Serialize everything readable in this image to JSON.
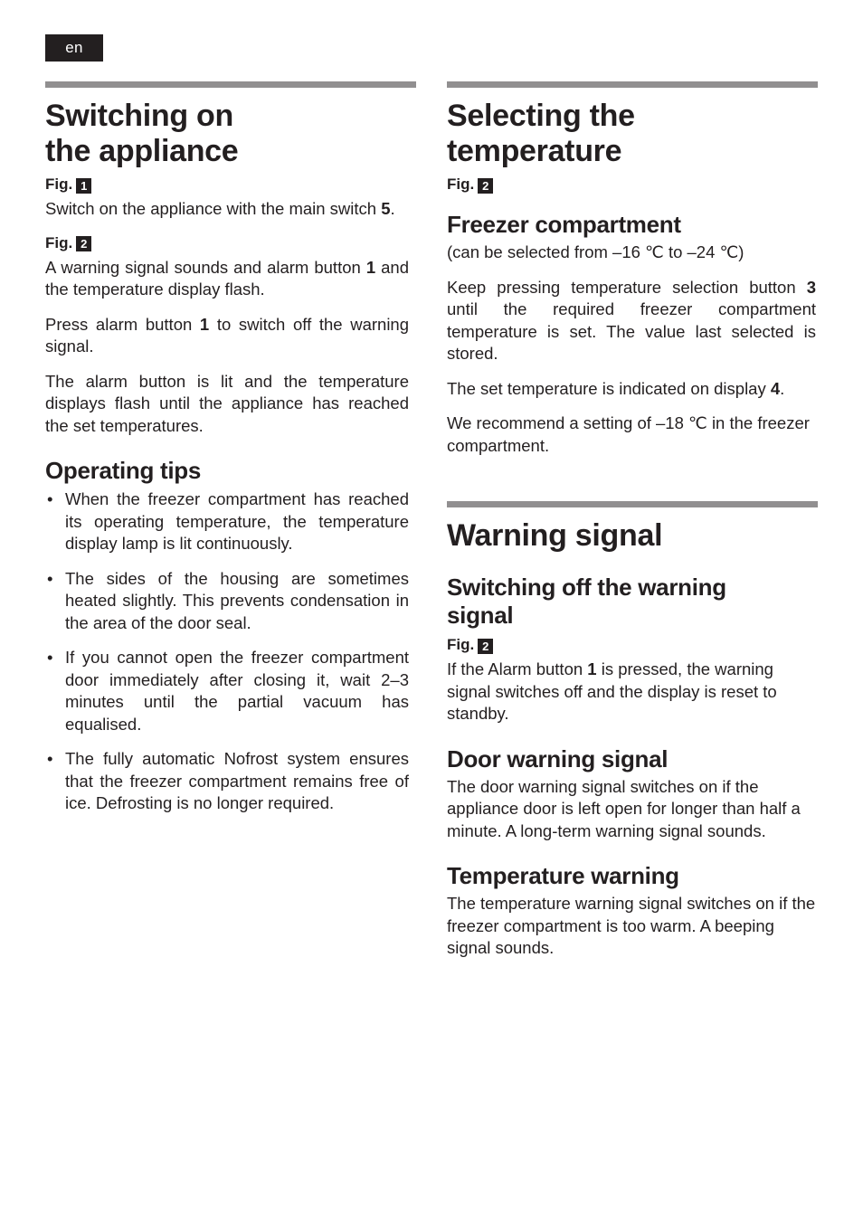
{
  "language_badge": "en",
  "left_column": {
    "section": {
      "title_line1": "Switching on",
      "title_line2": "the appliance"
    },
    "fig1": {
      "label": "Fig.",
      "number": "1"
    },
    "para_switch_on": "Switch on the appliance with the main switch 5.",
    "para_switch_on_parts": {
      "a": "Switch on the appliance with the main switch ",
      "bold": "5",
      "b": "."
    },
    "fig2": {
      "label": "Fig.",
      "number": "2"
    },
    "para_warning_parts": {
      "a": "A warning signal sounds and alarm button ",
      "bold": "1",
      "b": " and the temperature display flash."
    },
    "para_press_parts": {
      "a": "Press alarm button ",
      "bold": "1",
      "b": " to switch off the warning signal."
    },
    "para_alarm_lit": "The alarm button is lit and the temperature displays flash until the appliance has reached the set temperatures.",
    "operating_tips": {
      "heading": "Operating tips",
      "items": [
        "When the freezer compartment has reached its operating temperature, the temperature display lamp is lit continuously.",
        "The sides of the housing are sometimes heated slightly. This prevents condensation in the area of the door seal.",
        "If you cannot open the freezer compartment door immediately after closing it, wait 2–3 minutes until the partial vacuum has equalised.",
        "The fully automatic Nofrost system ensures that the freezer compartment remains free of ice. Defrosting is no longer required."
      ]
    }
  },
  "right_column": {
    "section_temperature": {
      "title_line1": "Selecting the",
      "title_line2": "temperature",
      "fig": {
        "label": "Fig.",
        "number": "2"
      },
      "sub_heading": "Freezer compartment",
      "range_note": "(can be selected from –16 ℃ to –24 ℃)",
      "para_keep_pressing_parts": {
        "a": "Keep pressing temperature selection button ",
        "bold": "3",
        "b": " until the required freezer compartment temperature is set. The value last selected is stored."
      },
      "para_display_parts": {
        "a": "The set temperature is indicated on display ",
        "bold": "4",
        "b": "."
      },
      "para_recommend": "We recommend a setting of –18 ℃ in the freezer compartment."
    },
    "section_warning": {
      "title": "Warning signal",
      "sub_switching_off_line1": "Switching off the warning",
      "sub_switching_off_line2": "signal",
      "fig": {
        "label": "Fig.",
        "number": "2"
      },
      "para_alarm_parts": {
        "a": "If the Alarm button ",
        "bold": "1",
        "b": " is pressed, the warning signal switches off and the display is reset to standby."
      },
      "sub_door_warning": "Door warning signal",
      "para_door_warning": "The door warning signal switches on if the appliance door is left open for longer than half a minute. A long-term warning signal sounds.",
      "sub_temperature_warning": "Temperature warning",
      "para_temperature_warning": "The temperature warning signal switches on if the freezer compartment is too warm. A beeping signal sounds."
    }
  },
  "colors": {
    "text": "#231f20",
    "rule": "#918f90",
    "badge_bg": "#231f20",
    "badge_text": "#ffffff",
    "page_bg": "#ffffff"
  }
}
